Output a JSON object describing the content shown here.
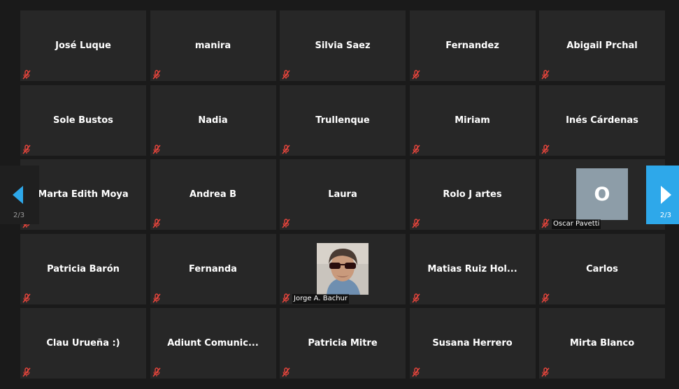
{
  "participants": [
    {
      "name": "José Luque",
      "muted": true
    },
    {
      "name": "manira",
      "muted": true
    },
    {
      "name": "Silvia Saez",
      "muted": true
    },
    {
      "name": "Fernandez",
      "muted": true
    },
    {
      "name": "Abigail Prchal",
      "muted": true
    },
    {
      "name": "Sole Bustos",
      "muted": true
    },
    {
      "name": "Nadia",
      "muted": true
    },
    {
      "name": "Trullenque",
      "muted": true
    },
    {
      "name": "Miriam",
      "muted": true
    },
    {
      "name": "Inés Cárdenas",
      "muted": true
    },
    {
      "name": "Marta Edith Moya",
      "muted": true
    },
    {
      "name": "Andrea B",
      "muted": true
    },
    {
      "name": "Laura",
      "muted": true
    },
    {
      "name": "Rolo J artes",
      "muted": true
    },
    {
      "name": "Oscar Pavetti",
      "muted": true,
      "avatar_letter": "O"
    },
    {
      "name": "Patricia Barón",
      "muted": true
    },
    {
      "name": "Fernanda",
      "muted": true
    },
    {
      "name": "Jorge A. Bachur",
      "muted": true,
      "has_photo": true
    },
    {
      "name": "Matias  Ruiz  Hol...",
      "muted": true
    },
    {
      "name": "Carlos",
      "muted": true
    },
    {
      "name": "Clau Urueña :)",
      "muted": true
    },
    {
      "name": "Adiunt  Comunic...",
      "muted": true
    },
    {
      "name": "Patricia Mitre",
      "muted": true
    },
    {
      "name": "Susana Herrero",
      "muted": true
    },
    {
      "name": "Mirta Blanco",
      "muted": true
    }
  ],
  "pagination": {
    "prev": {
      "icon": "arrow-left-icon",
      "page": "2/3"
    },
    "next": {
      "icon": "arrow-right-icon",
      "page": "2/3"
    }
  },
  "colors": {
    "background": "#1a1a1a",
    "tile": "#272727",
    "muted_icon": "#e8453c",
    "accent": "#2ea8ea",
    "avatar": "#8d9da8"
  }
}
